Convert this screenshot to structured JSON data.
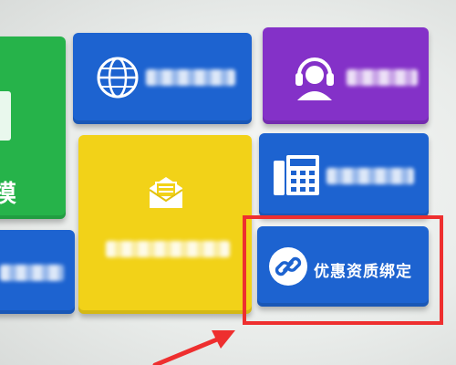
{
  "tiles": {
    "green": {
      "glyph": "摸"
    },
    "binding": {
      "label": "优惠资质绑定"
    }
  },
  "colors": {
    "green": "#26b34a",
    "blue": "#1d63d0",
    "purple": "#8431c8",
    "yellow": "#f2d218",
    "highlight": "#ee2f2f"
  },
  "icons": [
    "globe-icon",
    "headset-icon",
    "mail-icon",
    "phone-icon",
    "link-icon"
  ]
}
